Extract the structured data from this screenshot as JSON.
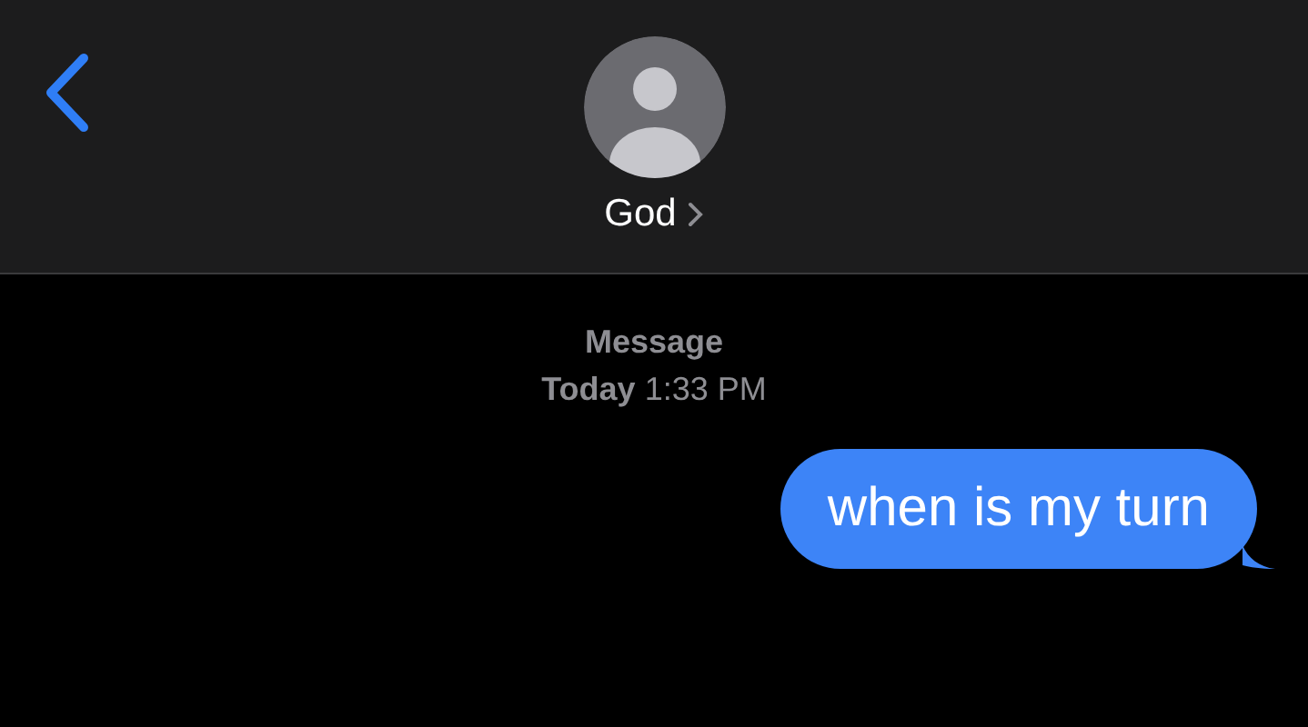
{
  "header": {
    "contact_name": "God"
  },
  "conversation": {
    "service": "Message",
    "timestamp": "**Today** 1:33 PM"
  },
  "messages": [
    {
      "text": "when is my turn",
      "kind": "sent"
    }
  ]
}
